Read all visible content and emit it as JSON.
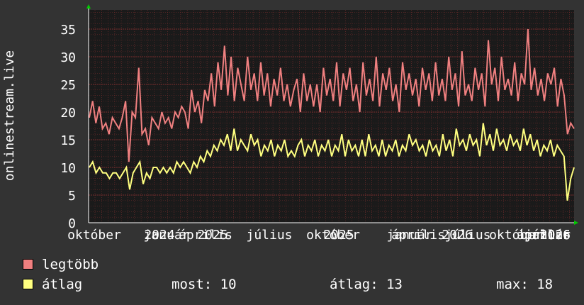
{
  "chart_data": {
    "type": "line",
    "ylabel": "onlinestream.live",
    "ylim": [
      0,
      38
    ],
    "yticks": [
      0,
      5,
      10,
      15,
      20,
      25,
      30,
      35
    ],
    "x_tick_labels": [
      "október",
      "2024",
      "január",
      "április",
      "2025",
      "július",
      "október",
      "2025",
      "január",
      "április",
      "2026",
      "július",
      "október",
      "2026",
      "január",
      "április",
      "július",
      "2026"
    ],
    "grid": true,
    "colors": {
      "legtobb": "#f08080",
      "atlag": "#ffff80",
      "grid": "#7a2e2e",
      "background": "#1a1a1a"
    },
    "series": [
      {
        "name": "legtöbb",
        "values": [
          19,
          22,
          18,
          21,
          17,
          18,
          16,
          19,
          18,
          17,
          19,
          22,
          11,
          20,
          19,
          28,
          16,
          17,
          14,
          19,
          18,
          17,
          20,
          18,
          19,
          17,
          20,
          19,
          21,
          20,
          17,
          24,
          20,
          22,
          18,
          24,
          22,
          27,
          21,
          29,
          24,
          32,
          23,
          30,
          22,
          28,
          25,
          22,
          30,
          24,
          27,
          22,
          29,
          23,
          27,
          21,
          26,
          23,
          28,
          22,
          25,
          21,
          24,
          26,
          20,
          27,
          22,
          25,
          21,
          25,
          20,
          28,
          23,
          26,
          22,
          29,
          21,
          27,
          24,
          28,
          22,
          25,
          20,
          29,
          23,
          26,
          22,
          30,
          21,
          27,
          24,
          28,
          22,
          25,
          20,
          29,
          24,
          27,
          23,
          26,
          21,
          28,
          24,
          27,
          22,
          29,
          23,
          26,
          22,
          30,
          24,
          27,
          21,
          31,
          23,
          25,
          22,
          28,
          24,
          27,
          21,
          33,
          25,
          28,
          22,
          30,
          24,
          26,
          23,
          29,
          22,
          27,
          25,
          35,
          24,
          28,
          23,
          26,
          22,
          27,
          25,
          28,
          21,
          26,
          23,
          16,
          18,
          17
        ]
      },
      {
        "name": "átlag",
        "values": [
          10,
          11,
          9,
          10,
          9,
          9,
          8,
          9,
          9,
          8,
          9,
          10,
          6,
          9,
          10,
          11,
          7,
          9,
          8,
          10,
          10,
          9,
          10,
          9,
          10,
          9,
          11,
          10,
          11,
          10,
          9,
          11,
          10,
          12,
          11,
          13,
          12,
          14,
          13,
          15,
          14,
          16,
          13,
          17,
          13,
          15,
          14,
          13,
          16,
          14,
          15,
          12,
          14,
          13,
          15,
          12,
          14,
          13,
          15,
          12,
          13,
          12,
          14,
          15,
          12,
          14,
          13,
          15,
          12,
          14,
          13,
          15,
          12,
          14,
          13,
          16,
          12,
          15,
          13,
          14,
          12,
          15,
          12,
          16,
          13,
          14,
          12,
          15,
          12,
          14,
          13,
          15,
          12,
          14,
          13,
          16,
          14,
          15,
          13,
          14,
          12,
          15,
          13,
          14,
          12,
          16,
          13,
          15,
          12,
          17,
          14,
          15,
          13,
          16,
          14,
          15,
          12,
          18,
          14,
          16,
          13,
          17,
          14,
          15,
          13,
          16,
          14,
          15,
          13,
          17,
          14,
          16,
          13,
          15,
          12,
          14,
          13,
          15,
          12,
          14,
          13,
          12,
          4,
          8,
          10
        ]
      }
    ]
  },
  "legend": {
    "items": [
      {
        "label": "legtöbb",
        "color": "#f08080"
      },
      {
        "label": "átlag",
        "color": "#ffff80"
      }
    ],
    "stats": {
      "most_label": "most:",
      "most_value": "10",
      "atlag_label": "átlag:",
      "atlag_value": "13",
      "max_label": "max:",
      "max_value": "18"
    }
  }
}
